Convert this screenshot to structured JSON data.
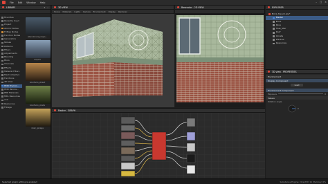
{
  "menubar": {
    "items": [
      "File",
      "Edit",
      "Window",
      "Help"
    ]
  },
  "library": {
    "title": "LIBRARY",
    "tree": [
      {
        "label": "Favorites",
        "color": "#7a7a7a"
      },
      {
        "label": "Recently Used",
        "color": "#7a7a7a"
      },
      {
        "label": "Project",
        "color": "#7a7a7a"
      },
      {
        "label": "Atomic Nodes",
        "color": "#c98a3a"
      },
      {
        "label": "FxMap Nodes",
        "color": "#c98a3a"
      },
      {
        "label": "Function Nodes",
        "color": "#7a7a7a"
      },
      {
        "label": "Generators",
        "color": "#7a7a7a"
      },
      {
        "label": "Noises",
        "color": "#7a7a7a"
      },
      {
        "label": "Patterns",
        "color": "#7a7a7a"
      },
      {
        "label": "Filters",
        "color": "#7a7a7a"
      },
      {
        "label": "Adjustments",
        "color": "#7a7a7a"
      },
      {
        "label": "Blending",
        "color": "#7a7a7a"
      },
      {
        "label": "Blurs",
        "color": "#7a7a7a"
      },
      {
        "label": "Channels",
        "color": "#7a7a7a"
      },
      {
        "label": "Effects",
        "color": "#7a7a7a"
      },
      {
        "label": "Material Filters",
        "color": "#7a7a7a"
      },
      {
        "label": "Mesh Adaptive",
        "color": "#7a7a7a"
      },
      {
        "label": "Functions",
        "color": "#7a7a7a"
      },
      {
        "label": "3D View",
        "color": "#7a7a7a"
      },
      {
        "label": "HDR Environ...",
        "color": "#4f8ad8"
      },
      {
        "label": "HDR Panora...",
        "color": "#7a7a7a"
      },
      {
        "label": "PBR Materials",
        "color": "#7a7a7a"
      },
      {
        "label": "MDL Resources",
        "color": "#7a7a7a"
      },
      {
        "label": "mdl",
        "color": "#7a7a7a"
      },
      {
        "label": "Resources",
        "color": "#7a7a7a"
      },
      {
        "label": "Foliage",
        "color": "#7a7a7a"
      }
    ],
    "selected_index": 19,
    "thumbs": [
      {
        "label": "abandoned_pospo...",
        "c1": "#4a5a6a",
        "c2": "#1e2226"
      },
      {
        "label": "airport",
        "c1": "#8aa0b8",
        "c2": "#2d3540"
      },
      {
        "label": "bonifacio_street",
        "c1": "#b8864a",
        "c2": "#2a1e14"
      },
      {
        "label": "bonifacio_stude",
        "c1": "#6e8048",
        "c2": "#1a2010"
      },
      {
        "label": "dusk_garage",
        "c1": "#c5a35a",
        "c2": "#201a10"
      }
    ]
  },
  "view3d": {
    "title": "3D VIEW",
    "menu": [
      "Scene",
      "Materials",
      "Lights",
      "Camera",
      "Environment",
      "Display",
      "Renderer"
    ]
  },
  "view2d": {
    "title": "Basecolor - 2D VIEW"
  },
  "explorer": {
    "title": "EXPLORER",
    "items": [
      {
        "label": "Brick_Stencil.sbs*",
        "indent": 0,
        "color": "#e0453a",
        "selected": false
      },
      {
        "label": "Master",
        "indent": 1,
        "color": "#4f8ad8",
        "selected": true
      },
      {
        "label": "Brick",
        "indent": 1,
        "color": "#8a8a8a",
        "selected": false
      },
      {
        "label": "Pave",
        "indent": 1,
        "color": "#8a8a8a",
        "selected": false
      },
      {
        "label": "Tiles_Star",
        "indent": 1,
        "color": "#8a8a8a",
        "selected": false
      },
      {
        "label": "Roof",
        "indent": 1,
        "color": "#8a8a8a",
        "selected": false
      },
      {
        "label": "Ornate",
        "indent": 1,
        "color": "#8a8a8a",
        "selected": false
      },
      {
        "label": "Window",
        "indent": 1,
        "color": "#8a8a8a",
        "selected": false
      },
      {
        "label": "Resources",
        "indent": 1,
        "color": "#8a8a8a",
        "selected": false
      }
    ]
  },
  "properties": {
    "title": "3D view - PROPERTIES",
    "sections": {
      "environment": "Environment",
      "display": "Display Component",
      "env_comp": "Environment Component",
      "exposure_label": "Exposure",
      "exposure_value": "0",
      "load_label": "Load",
      "values_label": "Values",
      "rotation_label": "Rotation angle",
      "rotation_value": "0"
    }
  },
  "graph": {
    "title": "Master - GRAPH"
  },
  "status": {
    "left": "Selected graph editing is enabled",
    "right": "Substance Engine: Direct3D 11  Memory: 0%"
  },
  "window": {
    "min": "–",
    "max": "□",
    "close": "×"
  }
}
